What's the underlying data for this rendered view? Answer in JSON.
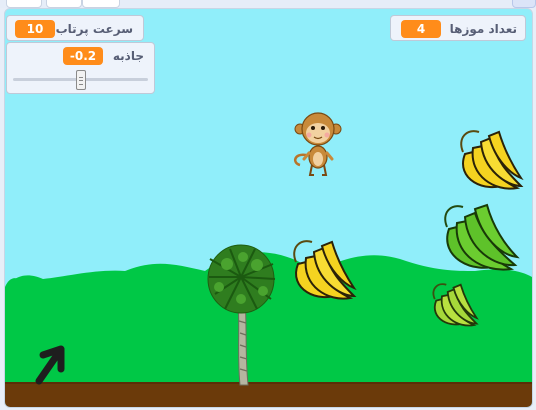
{
  "monitors": {
    "banana_count": {
      "label": "تعداد موزها",
      "value": "4"
    },
    "throw_speed": {
      "label": "سرعت پرتاب",
      "value": "10"
    },
    "gravity": {
      "label": "جاذبه",
      "value": "-0.2",
      "slider_fraction": 0.5
    }
  },
  "sprites": [
    "monkey-sprite",
    "banana-bunch",
    "palm-tree",
    "arrow-icon"
  ],
  "colors": {
    "sky": "#90eefa",
    "hills": "#00c846",
    "ground": "#6b3a0a",
    "monitor_value": "#ff8c1a",
    "banana_yellow": "#f5d320",
    "banana_green": "#5ec22a"
  }
}
